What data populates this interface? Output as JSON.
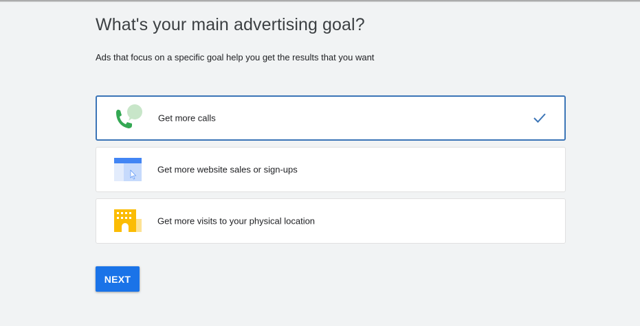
{
  "page": {
    "heading": "What's your main advertising goal?",
    "subheading": "Ads that focus on a specific goal help you get the results that you want"
  },
  "options": [
    {
      "label": "Get more calls",
      "icon": "phone-chat-icon",
      "selected": true
    },
    {
      "label": "Get more website sales or sign-ups",
      "icon": "webpage-cursor-icon",
      "selected": false
    },
    {
      "label": "Get more visits to your physical location",
      "icon": "building-icon",
      "selected": false
    }
  ],
  "actions": {
    "next_label": "NEXT"
  },
  "colors": {
    "background": "#f1f3f4",
    "selected_border": "#3a74b6",
    "primary_button": "#1a73e8",
    "check": "#3a74b6"
  }
}
